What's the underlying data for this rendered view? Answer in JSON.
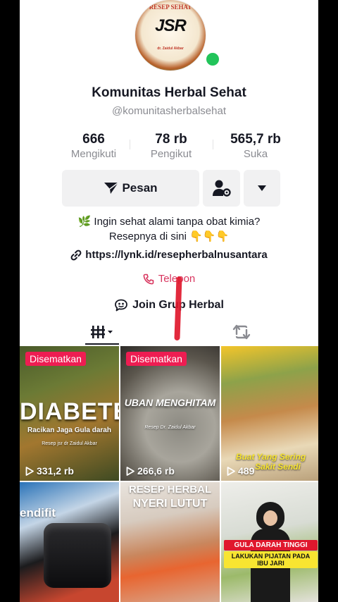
{
  "profile": {
    "avatar_text_top": "RESEP SEHAT",
    "avatar_logo": "JSR",
    "avatar_author": "dr. Zaidul Akbar",
    "name": "Komunitas Herbal Sehat",
    "handle": "@komunitasherbalsehat"
  },
  "stats": [
    {
      "value": "666",
      "label": "Mengikuti"
    },
    {
      "value": "78 rb",
      "label": "Pengikut"
    },
    {
      "value": "565,7 rb",
      "label": "Suka"
    }
  ],
  "actions": {
    "message_label": "Pesan",
    "add_friend_icon": "person-gear-icon",
    "more_icon": "caret-down-icon"
  },
  "bio": {
    "line1": "🌿 Ingin sehat alami tanpa obat kimia?",
    "line2": "Resepnya di sini 👇👇👇",
    "link": "https://lynk.id/resepherbalnusantara",
    "phone_label": "Telepon",
    "group_label": "Join Grup Herbal"
  },
  "tabs": [
    "videos-grid-tab",
    "repost-tab"
  ],
  "videos": [
    {
      "pinned": "Disematkan",
      "title": "DIABETES",
      "subtitle": "Racikan Jaga Gula darah",
      "caption": "Resep jsr dr Zaidul Akbar",
      "views": "331,2 rb"
    },
    {
      "pinned": "Disematkan",
      "title": "UBAN MENGHITAM",
      "caption": "Resep Dr. Zaidul Akbar",
      "views": "266,6 rb"
    },
    {
      "title": "Buat Yang Sering",
      "subtitle": "Sakit Sendi",
      "views": "489"
    },
    {
      "title": "endifit"
    },
    {
      "title": "RESEP HERBAL",
      "subtitle": "NYERI LUTUT"
    },
    {
      "title": "GULA DARAH TINGGI",
      "subtitle": "LAKUKAN PIJATAN PADA IBU JARI"
    }
  ],
  "colors": {
    "accent_red": "#ee1d52",
    "phone_pink": "#d8365f",
    "online_green": "#22c45a"
  }
}
